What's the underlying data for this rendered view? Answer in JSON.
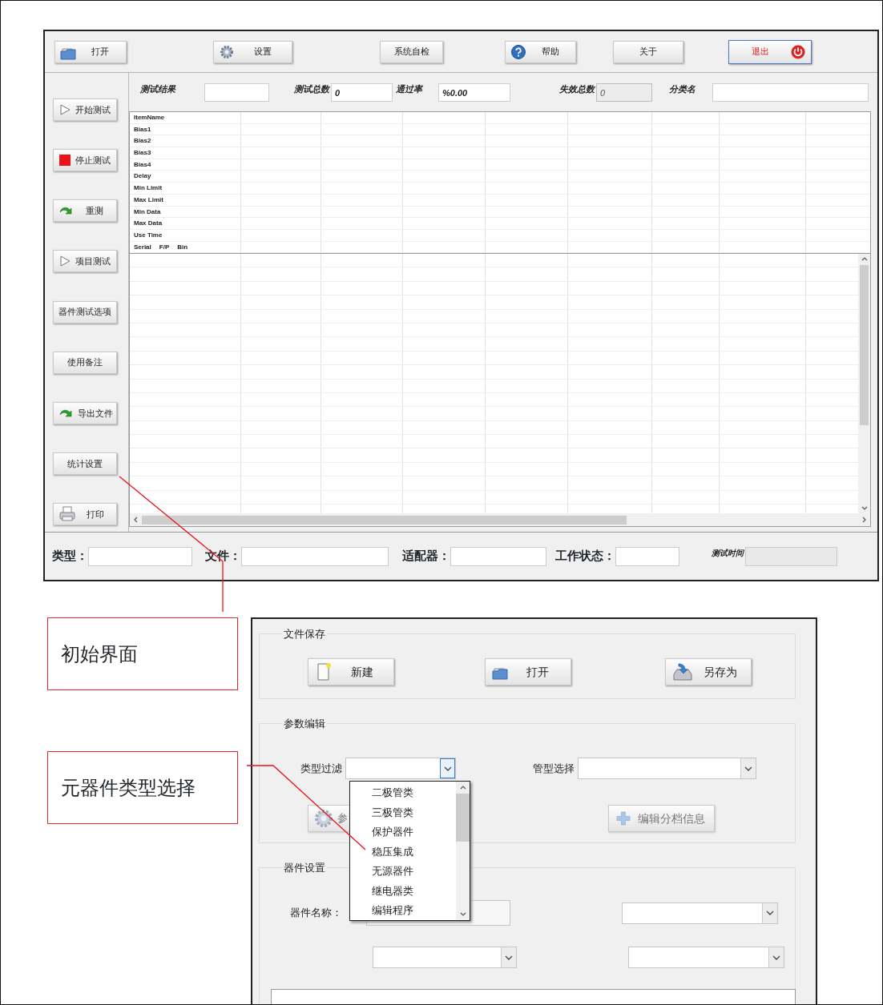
{
  "main_window": {
    "toolbar": [
      {
        "label": "打开",
        "kind": "open"
      },
      {
        "label": "设置",
        "kind": "gear"
      },
      {
        "label": "系统自检",
        "kind": "plain"
      },
      {
        "label": "帮助",
        "kind": "help"
      },
      {
        "label": "关于",
        "kind": "plain"
      },
      {
        "label": "退出",
        "kind": "power"
      }
    ],
    "sidebar": [
      {
        "label": "开始测试",
        "kind": "play"
      },
      {
        "label": "停止测试",
        "kind": "stop"
      },
      {
        "label": "重测",
        "kind": "redo"
      },
      {
        "label": "项目测试",
        "kind": "play"
      },
      {
        "label": "器件测试选项",
        "kind": "plain"
      },
      {
        "label": "使用备注",
        "kind": "plain"
      },
      {
        "label": "导出文件",
        "kind": "redo"
      },
      {
        "label": "统计设置",
        "kind": "plain"
      },
      {
        "label": "打印",
        "kind": "print"
      }
    ],
    "summary": [
      {
        "label": "测试结果",
        "disabled": false
      },
      {
        "label": "测试总数",
        "value": "0",
        "disabled": false
      },
      {
        "label": "通过率",
        "value": "%0.00",
        "disabled": false
      },
      {
        "label": "失效总数",
        "value": "0",
        "disabled": true
      },
      {
        "label": "分类名",
        "disabled": false
      }
    ],
    "result_grid": {
      "rows": [
        "ItemName",
        "Bias1",
        "Bias2",
        "Bias3",
        "Bias4",
        "Delay",
        "Min Limit",
        "Max Limit",
        "Min Data",
        "Max Data",
        "Use Time"
      ],
      "last_row": [
        "Serial",
        "F/P",
        "Bin"
      ]
    },
    "status_fields": [
      {
        "label": "类型：",
        "kind": "label",
        "disabled": false
      },
      {
        "label": "文件：",
        "kind": "label",
        "disabled": false
      },
      {
        "label": "适配器：",
        "kind": "label",
        "disabled": false
      },
      {
        "label": "工作状态：",
        "kind": "label",
        "disabled": false
      },
      {
        "label": "测试时间",
        "kind": "caption",
        "disabled": true
      }
    ]
  },
  "annotations": [
    {
      "text": "初始界面"
    },
    {
      "text": "元器件类型选择"
    }
  ],
  "dialog": {
    "file_group": {
      "title": "文件保存",
      "buttons": [
        {
          "label": "新建",
          "kind": "new"
        },
        {
          "label": "打开",
          "kind": "open"
        },
        {
          "label": "另存为",
          "kind": "save"
        }
      ]
    },
    "param_group": {
      "title": "参数编辑",
      "type_filter": {
        "label": "类型过滤",
        "focused": true,
        "expanded": true,
        "options": [
          "二极管类",
          "三极管类",
          "保护器件",
          "稳压集成",
          "无源器件",
          "继电器类",
          "编辑程序"
        ]
      },
      "tube_select": {
        "label": "管型选择",
        "focused": false
      },
      "buttons": [
        {
          "label": "参",
          "kind": "gear",
          "disabled": true
        },
        {
          "label": "编辑分档信息",
          "kind": "plus",
          "disabled": true
        }
      ]
    },
    "device_group": {
      "title": "器件设置",
      "name_label": "器件名称："
    }
  }
}
